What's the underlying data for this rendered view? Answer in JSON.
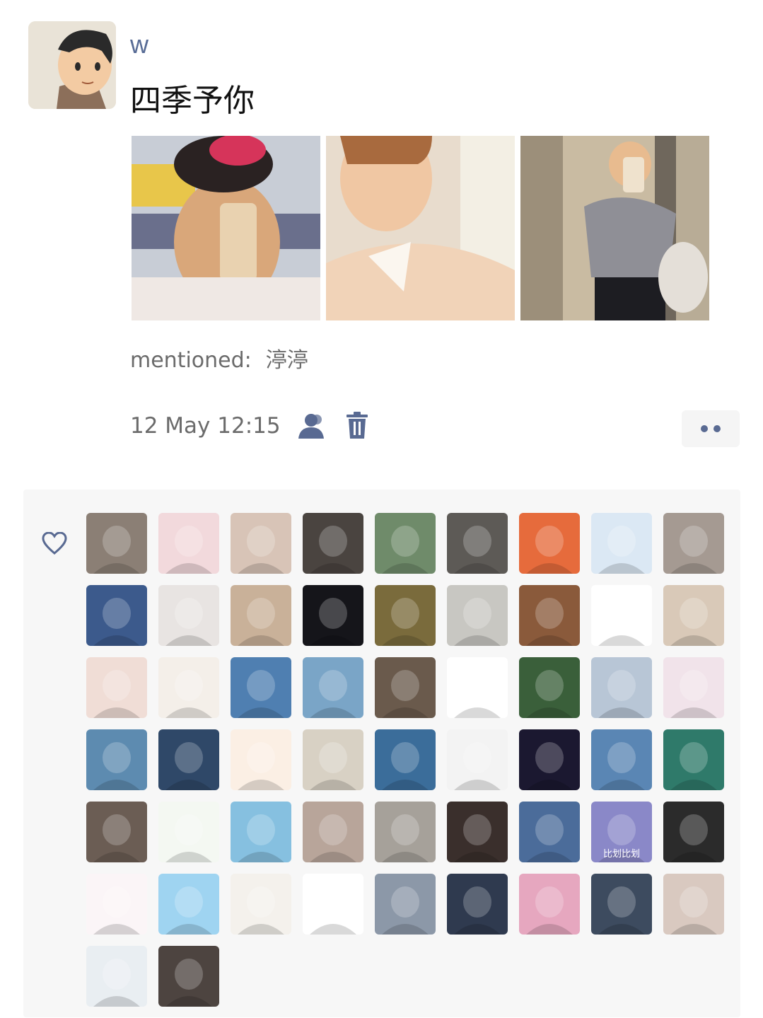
{
  "post": {
    "username": "w",
    "text": "四季予你",
    "photos": [
      {
        "icon": "selfie-photo",
        "colors": [
          "#c8cdd6",
          "#d9a77a"
        ]
      },
      {
        "icon": "portrait-photo",
        "colors": [
          "#e8dccd",
          "#f1d3b8"
        ]
      },
      {
        "icon": "mirror-selfie-photo",
        "colors": [
          "#b8ac96",
          "#8f8f96"
        ]
      }
    ],
    "mentioned_label": "mentioned:",
    "mentioned_name": "渟渟",
    "timestamp": "12 May 12:15"
  },
  "colors": {
    "link": "#576b95",
    "icon": "#596a92",
    "likes_bg": "#f7f7f7"
  },
  "likes": {
    "icon": "heart-icon",
    "avatars": [
      {
        "bg": "#8b7f75"
      },
      {
        "bg": "#f2d9dc"
      },
      {
        "bg": "#d8c4b7"
      },
      {
        "bg": "#4a4440"
      },
      {
        "bg": "#6f8b6a"
      },
      {
        "bg": "#5d5a56"
      },
      {
        "bg": "#e66b3c"
      },
      {
        "bg": "#dbe8f4"
      },
      {
        "bg": "#a59a92"
      },
      {
        "bg": "#3c5a8c"
      },
      {
        "bg": "#e8e4e2"
      },
      {
        "bg": "#c9b199"
      },
      {
        "bg": "#15151a"
      },
      {
        "bg": "#7a6b3c"
      },
      {
        "bg": "#c8c7c2"
      },
      {
        "bg": "#8a5a3b"
      },
      {
        "bg": "#ffffff"
      },
      {
        "bg": "#d9c9b8"
      },
      {
        "bg": "#f0ddd6"
      },
      {
        "bg": "#f4efe9"
      },
      {
        "bg": "#4f7fb1"
      },
      {
        "bg": "#7aa5c7"
      },
      {
        "bg": "#6a5a4c"
      },
      {
        "bg": "#ffffff"
      },
      {
        "bg": "#3a5f3a"
      },
      {
        "bg": "#b8c6d6"
      },
      {
        "bg": "#f1e3ea"
      },
      {
        "bg": "#5d8bb0"
      },
      {
        "bg": "#2f4868"
      },
      {
        "bg": "#fbefe4"
      },
      {
        "bg": "#d8d1c4"
      },
      {
        "bg": "#3b6d9a"
      },
      {
        "bg": "#f3f3f3"
      },
      {
        "bg": "#1b1830"
      },
      {
        "bg": "#5a86b4"
      },
      {
        "bg": "#2f7a6a"
      },
      {
        "bg": "#6b5d54"
      },
      {
        "bg": "#f4f8f2"
      },
      {
        "bg": "#86c0e0"
      },
      {
        "bg": "#b8a59a"
      },
      {
        "bg": "#a6a19a"
      },
      {
        "bg": "#3a2f2c"
      },
      {
        "bg": "#4b6c9a"
      },
      {
        "bg": "#8a88c8"
      },
      {
        "bg": "#2b2b2b"
      },
      {
        "bg": "#fbf5f7"
      },
      {
        "bg": "#9fd4f1"
      },
      {
        "bg": "#f4f1ec"
      },
      {
        "bg": "#ffffff"
      },
      {
        "bg": "#8c98a8"
      },
      {
        "bg": "#2f3a4f"
      },
      {
        "bg": "#e6a7bf"
      },
      {
        "bg": "#3d4b5f"
      },
      {
        "bg": "#d9c9c0"
      },
      {
        "bg": "#e9eef2"
      },
      {
        "bg": "#4d4440"
      }
    ],
    "avatar_caption": "比划比划"
  }
}
